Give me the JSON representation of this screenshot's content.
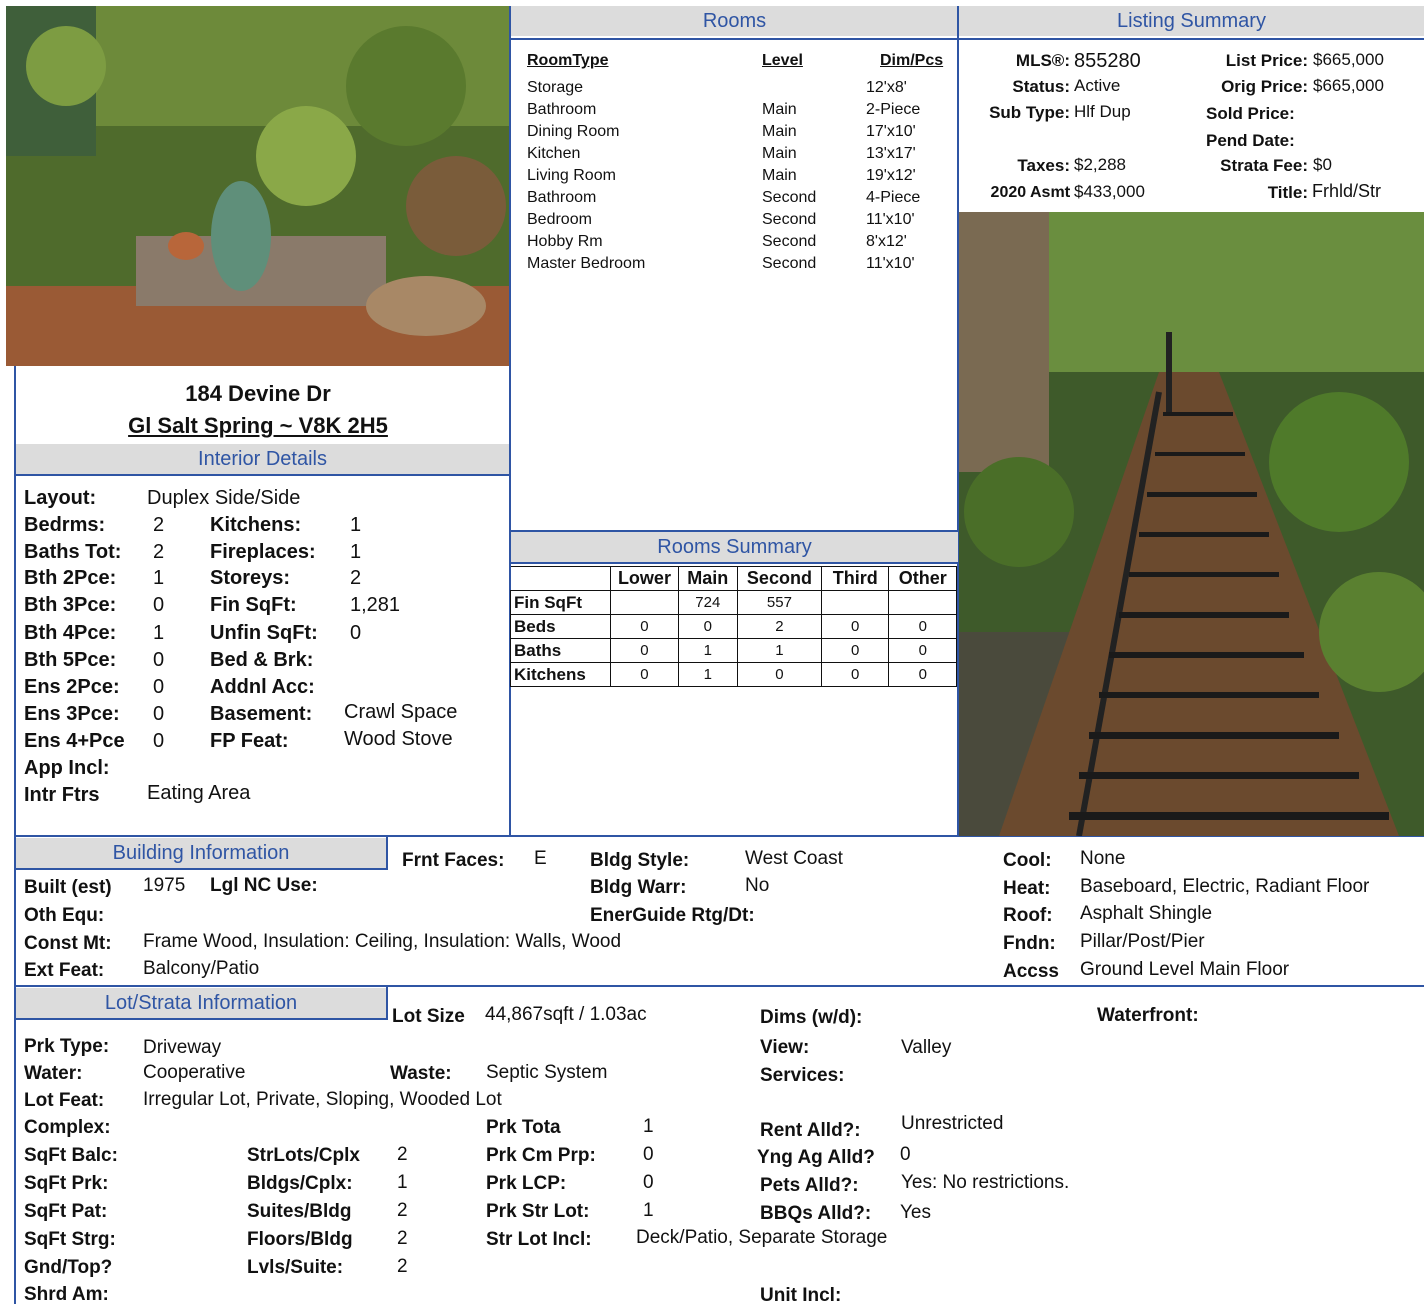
{
  "address": {
    "line1": "184 Devine Dr",
    "line2": "Gl Salt Spring  ~  V8K 2H5"
  },
  "sections": {
    "rooms": "Rooms",
    "listing_summary": "Listing Summary",
    "interior": "Interior Details",
    "rooms_summary": "Rooms Summary",
    "building": "Building Information",
    "lot": "Lot/Strata Information"
  },
  "rooms": {
    "headers": [
      "RoomType",
      "Level",
      "Dim/Pcs"
    ],
    "rows": [
      [
        "Storage",
        "",
        "12'x8'"
      ],
      [
        "Bathroom",
        "Main",
        "2-Piece"
      ],
      [
        "Dining Room",
        "Main",
        "17'x10'"
      ],
      [
        "Kitchen",
        "Main",
        "13'x17'"
      ],
      [
        "Living Room",
        "Main",
        "19'x12'"
      ],
      [
        "Bathroom",
        "Second",
        "4-Piece"
      ],
      [
        "Bedroom",
        "Second",
        "11'x10'"
      ],
      [
        "Hobby Rm",
        "Second",
        "8'x12'"
      ],
      [
        "Master Bedroom",
        "Second",
        "11'x10'"
      ]
    ]
  },
  "listing": {
    "mls_label": "MLS®:",
    "mls": "855280",
    "status_label": "Status:",
    "status": "Active",
    "subtype_label": "Sub Type:",
    "subtype": "Hlf Dup",
    "taxes_label": "Taxes:",
    "taxes": "$2,288",
    "asmt_label": "2020 Asmt",
    "asmt": "$433,000",
    "list_price_label": "List Price:",
    "list_price": "$665,000",
    "orig_price_label": "Orig Price:",
    "orig_price": "$665,000",
    "sold_price_label": "Sold Price:",
    "pend_date_label": "Pend Date:",
    "strata_fee_label": "Strata Fee:",
    "strata_fee": "$0",
    "title_label": "Title:",
    "title": "Frhld/Str"
  },
  "rooms_summary": {
    "columns": [
      "Lower",
      "Main",
      "Second",
      "Third",
      "Other"
    ],
    "rows": [
      {
        "label": "Fin SqFt",
        "values": [
          "",
          "724",
          "557",
          "",
          ""
        ]
      },
      {
        "label": "Beds",
        "values": [
          "0",
          "0",
          "2",
          "0",
          "0"
        ]
      },
      {
        "label": "Baths",
        "values": [
          "0",
          "1",
          "1",
          "0",
          "0"
        ]
      },
      {
        "label": "Kitchens",
        "values": [
          "0",
          "1",
          "0",
          "0",
          "0"
        ]
      }
    ]
  },
  "interior": {
    "layout_label": "Layout:",
    "layout": "Duplex Side/Side",
    "bedrms_label": "Bedrms:",
    "bedrms": "2",
    "baths_tot_label": "Baths Tot:",
    "baths_tot": "2",
    "bth2_label": "Bth 2Pce:",
    "bth2": "1",
    "bth3_label": "Bth 3Pce:",
    "bth3": "0",
    "bth4_label": "Bth 4Pce:",
    "bth4": "1",
    "bth5_label": "Bth 5Pce:",
    "bth5": "0",
    "ens2_label": "Ens 2Pce:",
    "ens2": "0",
    "ens3_label": "Ens 3Pce:",
    "ens3": "0",
    "ens4_label": "Ens 4+Pce",
    "ens4": "0",
    "app_incl_label": "App Incl:",
    "intr_ftrs_label": "Intr Ftrs",
    "intr_ftrs": "Eating Area",
    "kitchens_label": "Kitchens:",
    "kitchens": "1",
    "fireplaces_label": "Fireplaces:",
    "fireplaces": "1",
    "storeys_label": "Storeys:",
    "storeys": "2",
    "fin_sqft_label": "Fin SqFt:",
    "fin_sqft": "1,281",
    "unfin_sqft_label": "Unfin SqFt:",
    "unfin_sqft": "0",
    "bed_brk_label": "Bed & Brk:",
    "addnl_acc_label": "Addnl Acc:",
    "basement_label": "Basement:",
    "basement": "Crawl Space",
    "fp_feat_label": "FP Feat:",
    "fp_feat": "Wood Stove"
  },
  "building": {
    "built_label": "Built (est)",
    "built": "1975",
    "lgl_nc_label": "Lgl NC Use:",
    "oth_equ_label": "Oth Equ:",
    "const_label": "Const Mt:",
    "const": "Frame Wood, Insulation: Ceiling, Insulation: Walls, Wood",
    "ext_label": "Ext Feat:",
    "ext": "Balcony/Patio",
    "frnt_label": "Frnt Faces:",
    "frnt": "E",
    "style_label": "Bldg Style:",
    "style": "West Coast",
    "warr_label": "Bldg Warr:",
    "warr": "No",
    "energuide_label": "EnerGuide Rtg/Dt:",
    "cool_label": "Cool:",
    "cool": "None",
    "heat_label": "Heat:",
    "heat": "Baseboard, Electric, Radiant Floor",
    "roof_label": "Roof:",
    "roof": "Asphalt Shingle",
    "fndn_label": "Fndn:",
    "fndn": "Pillar/Post/Pier",
    "accss_label": "Accss",
    "accss": "Ground Level Main Floor"
  },
  "lot": {
    "lot_size_label": "Lot Size",
    "lot_size": "44,867sqft / 1.03ac",
    "dims_label": "Dims (w/d):",
    "waterfront_label": "Waterfront:",
    "prk_type_label": "Prk Type:",
    "prk_type": "Driveway",
    "water_label": "Water:",
    "water": "Cooperative",
    "waste_label": "Waste:",
    "waste": "Septic System",
    "view_label": "View:",
    "view": "Valley",
    "services_label": "Services:",
    "lot_feat_label": "Lot Feat:",
    "lot_feat": "Irregular Lot, Private, Sloping, Wooded Lot",
    "complex_label": "Complex:",
    "sqft_balc_label": "SqFt Balc:",
    "sqft_prk_label": "SqFt Prk:",
    "sqft_pat_label": "SqFt Pat:",
    "sqft_strg_label": "SqFt Strg:",
    "gnd_top_label": "Gnd/Top?",
    "shrd_am_label": "Shrd Am:",
    "strlots_label": "StrLots/Cplx",
    "strlots": "2",
    "bldgs_label": "Bldgs/Cplx:",
    "bldgs": "1",
    "suites_label": "Suites/Bldg",
    "suites": "2",
    "floors_label": "Floors/Bldg",
    "floors": "2",
    "lvls_label": "Lvls/Suite:",
    "lvls": "2",
    "prk_tota_label": "Prk Tota",
    "prk_tota": "1",
    "prk_cm_label": "Prk Cm Prp:",
    "prk_cm": "0",
    "prk_lcp_label": "Prk LCP:",
    "prk_lcp": "0",
    "prk_str_label": "Prk Str Lot:",
    "prk_str": "1",
    "str_lot_incl_label": "Str Lot Incl:",
    "str_lot_incl": "Deck/Patio, Separate Storage",
    "rent_label": "Rent Alld?:",
    "rent": "Unrestricted",
    "yng_label": "Yng Ag Alld?",
    "yng": "0",
    "pets_label": "Pets Alld?:",
    "pets": "Yes: No restrictions.",
    "bbq_label": "BBQs Alld?:",
    "bbq": "Yes",
    "unit_incl_label": "Unit Incl:"
  }
}
